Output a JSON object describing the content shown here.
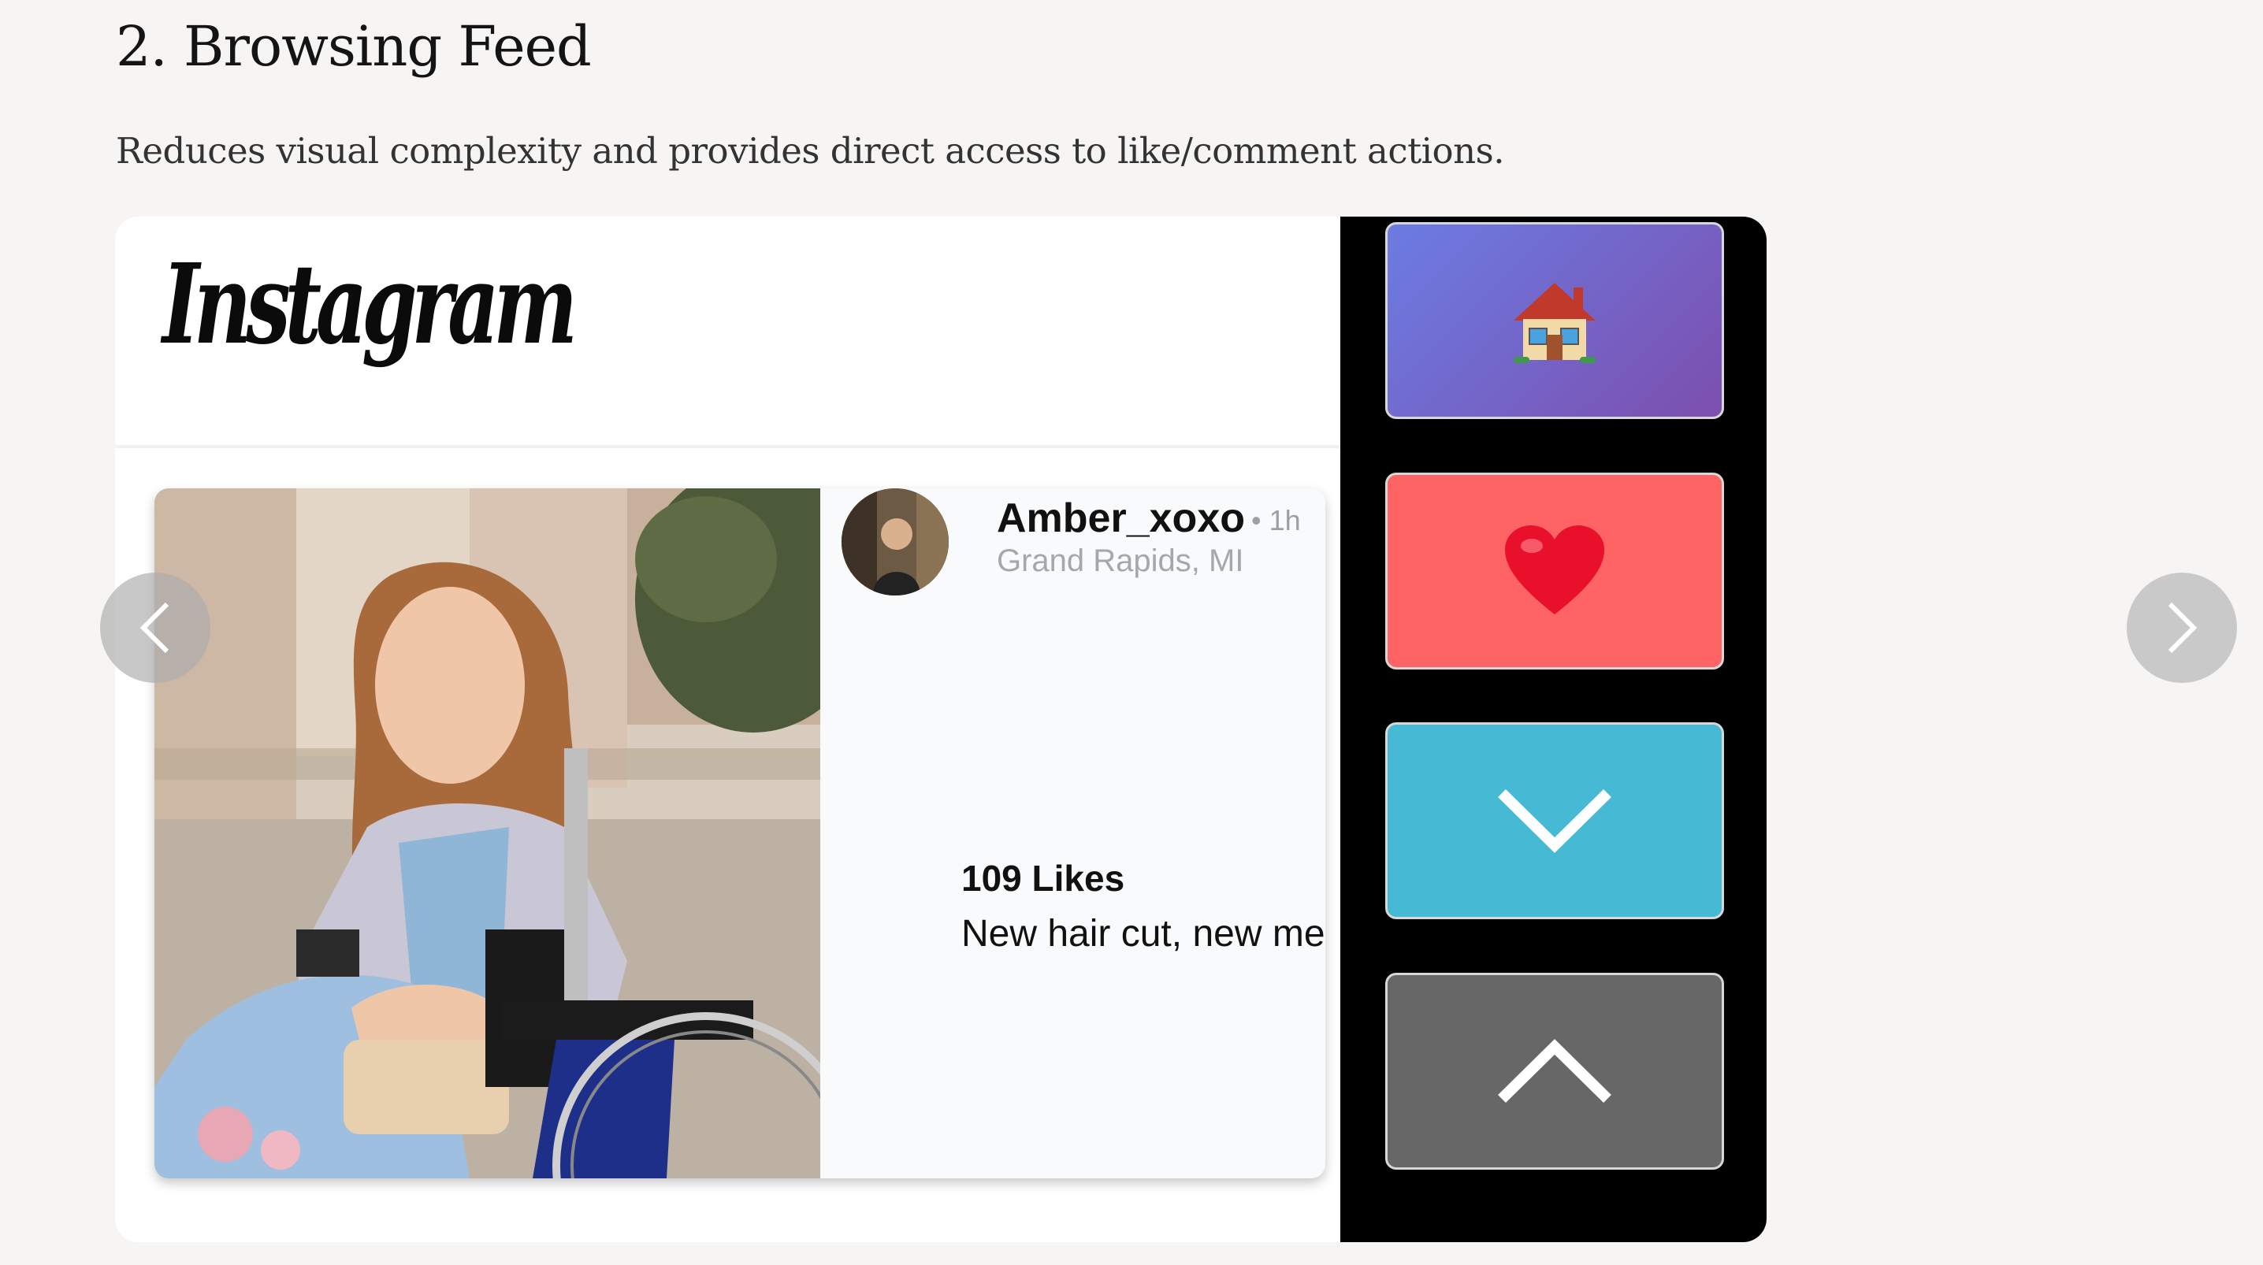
{
  "section": {
    "title": "2. Browsing Feed",
    "description": "Reduces visual complexity and provides direct access to like/comment actions."
  },
  "app": {
    "logo_text": "Instagram"
  },
  "post": {
    "username": "Amber_xoxo",
    "time": "• 1h",
    "location": "Grand Rapids, MI",
    "likes": "109 Likes",
    "caption": "New hair cut, new me!"
  },
  "controls": {
    "home_icon": "house-icon",
    "like_icon": "heart-icon",
    "down_icon": "chevron-down-icon",
    "up_icon": "chevron-up-icon"
  },
  "carousel": {
    "prev_icon": "chevron-left-icon",
    "next_icon": "chevron-right-icon"
  },
  "colors": {
    "home": "#6b7ce3",
    "like": "#ff6464",
    "down": "#46b9d4",
    "up": "#676767",
    "panel": "#000000"
  }
}
